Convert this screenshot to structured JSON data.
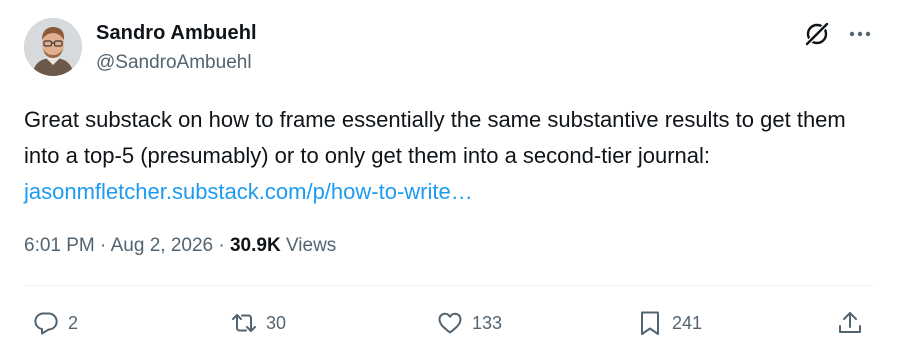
{
  "author": {
    "name": "Sandro Ambuehl",
    "handle": "@SandroAmbuehl"
  },
  "icons": {
    "grok": "grok-icon",
    "more": "more-options-icon",
    "reply": "reply-icon",
    "retweet": "retweet-icon",
    "like": "heart-icon",
    "bookmark": "bookmark-icon",
    "share": "share-icon"
  },
  "post": {
    "text": "Great substack on how to frame essentially the same substantive results to get them into a top-5 (presumably) or to only get them into a second-tier journal: ",
    "link_text": "jasonmfletcher.substack.com/p/how-to-write…"
  },
  "meta": {
    "time": "6:01 PM",
    "separator1": " · ",
    "date": "Aug 2, 2026",
    "separator2": " · ",
    "views_count": "30.9K",
    "views_label": " Views"
  },
  "actions": {
    "replies": "2",
    "retweets": "30",
    "likes": "133",
    "bookmarks": "241"
  },
  "colors": {
    "text": "#0f1419",
    "secondary": "#536471",
    "link": "#1d9bf0",
    "divider": "#eff3f4"
  }
}
